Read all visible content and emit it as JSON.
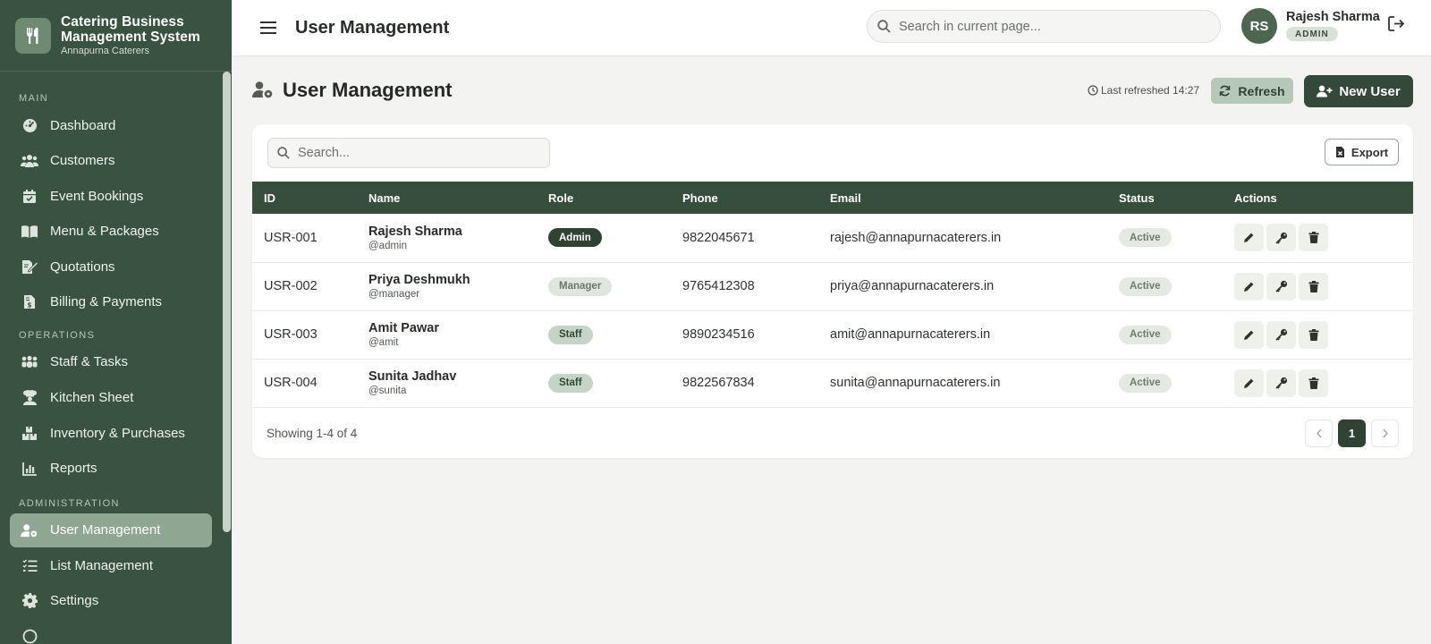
{
  "app": {
    "title": "Catering Business Management System",
    "company": "Annapurna Caterers"
  },
  "sidebar": {
    "sections": [
      {
        "label": "MAIN",
        "items": [
          {
            "label": "Dashboard",
            "icon": "dashboard-gauge-icon"
          },
          {
            "label": "Customers",
            "icon": "users-group-icon"
          },
          {
            "label": "Event Bookings",
            "icon": "calendar-check-icon"
          },
          {
            "label": "Menu & Packages",
            "icon": "book-open-icon"
          },
          {
            "label": "Quotations",
            "icon": "file-signature-icon"
          },
          {
            "label": "Billing & Payments",
            "icon": "invoice-dollar-icon"
          }
        ]
      },
      {
        "label": "OPERATIONS",
        "items": [
          {
            "label": "Staff & Tasks",
            "icon": "people-group-icon"
          },
          {
            "label": "Kitchen Sheet",
            "icon": "chef-icon"
          },
          {
            "label": "Inventory & Purchases",
            "icon": "boxes-icon"
          },
          {
            "label": "Reports",
            "icon": "bar-chart-icon"
          }
        ]
      },
      {
        "label": "ADMINISTRATION",
        "items": [
          {
            "label": "User Management",
            "icon": "user-gear-icon",
            "active": true
          },
          {
            "label": "List Management",
            "icon": "list-check-icon"
          },
          {
            "label": "Settings",
            "icon": "gear-icon"
          }
        ]
      }
    ]
  },
  "topbar": {
    "title": "User Management",
    "search_placeholder": "Search in current page...",
    "user": {
      "initials": "RS",
      "name": "Rajesh Sharma",
      "role": "ADMIN"
    }
  },
  "page": {
    "title": "User Management",
    "last_refreshed": "Last refreshed 14:27",
    "refresh_label": "Refresh",
    "new_user_label": "New User",
    "search_placeholder": "Search...",
    "export_label": "Export",
    "columns": [
      "ID",
      "Name",
      "Role",
      "Phone",
      "Email",
      "Status",
      "Actions"
    ],
    "rows": [
      {
        "id": "USR-001",
        "name": "Rajesh Sharma",
        "username": "@admin",
        "role": "Admin",
        "role_style": "admin",
        "phone": "9822045671",
        "email": "rajesh@annapurnacaterers.in",
        "status": "Active"
      },
      {
        "id": "USR-002",
        "name": "Priya Deshmukh",
        "username": "@manager",
        "role": "Manager",
        "role_style": "manager",
        "phone": "9765412308",
        "email": "priya@annapurnacaterers.in",
        "status": "Active"
      },
      {
        "id": "USR-003",
        "name": "Amit Pawar",
        "username": "@amit",
        "role": "Staff",
        "role_style": "staff",
        "phone": "9890234516",
        "email": "amit@annapurnacaterers.in",
        "status": "Active"
      },
      {
        "id": "USR-004",
        "name": "Sunita Jadhav",
        "username": "@sunita",
        "role": "Staff",
        "role_style": "staff",
        "phone": "9822567834",
        "email": "sunita@annapurnacaterers.in",
        "status": "Active"
      }
    ],
    "row_actions": [
      "edit-icon",
      "key-icon",
      "trash-icon"
    ],
    "showing": "Showing 1-4 of 4",
    "pagination": {
      "current": "1"
    }
  },
  "colors": {
    "sidebar_bg": "#3a5240",
    "accent_dark": "#34493a",
    "active_item": "#8fa693",
    "table_header": "#384e3d"
  }
}
